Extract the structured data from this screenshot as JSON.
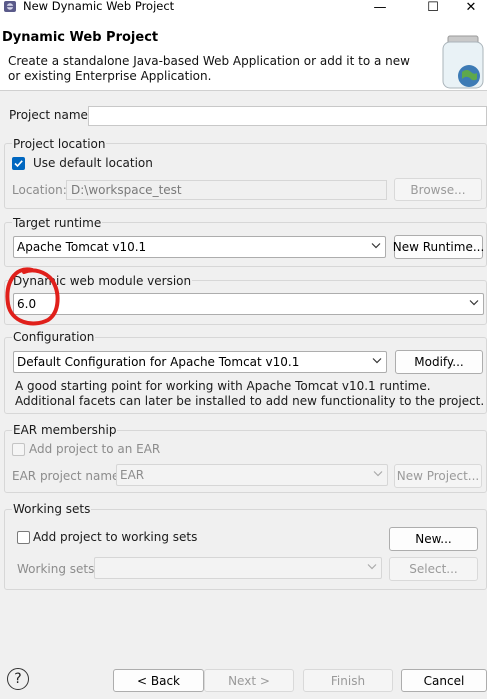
{
  "window": {
    "title": "New Dynamic Web Project",
    "minimize_glyph": "—",
    "maximize_glyph": "☐",
    "close_glyph": "✕"
  },
  "header": {
    "title": "Dynamic Web Project",
    "description": "Create a standalone Java-based Web Application or add it to a new or existing Enterprise Application."
  },
  "project_name": {
    "label": "Project name:",
    "value": ""
  },
  "project_location": {
    "group_label": "Project location",
    "use_default_label": "Use default location",
    "use_default_checked": true,
    "location_label": "Location:",
    "location_value": "D:\\workspace_test",
    "browse_label": "Browse..."
  },
  "target_runtime": {
    "group_label": "Target runtime",
    "selected": "Apache Tomcat v10.1",
    "new_runtime_label": "New Runtime..."
  },
  "module_version": {
    "group_label": "Dynamic web module version",
    "selected": "6.0",
    "annotation_color": "#e0201b"
  },
  "configuration": {
    "group_label": "Configuration",
    "selected": "Default Configuration for Apache Tomcat v10.1",
    "modify_label": "Modify...",
    "description": "A good starting point for working with Apache Tomcat v10.1 runtime. Additional facets can later be installed to add new functionality to the project."
  },
  "ear": {
    "group_label": "EAR membership",
    "add_label": "Add project to an EAR",
    "project_name_label": "EAR project name:",
    "project_name_value": "EAR",
    "new_project_label": "New Project..."
  },
  "working_sets": {
    "group_label": "Working sets",
    "add_label": "Add project to working sets",
    "new_label": "New...",
    "sets_label": "Working sets:",
    "sets_value": "",
    "select_label": "Select..."
  },
  "footer": {
    "help_glyph": "?",
    "back_label": "< Back",
    "next_label": "Next >",
    "finish_label": "Finish",
    "cancel_label": "Cancel"
  },
  "colors": {
    "accent": "#0067c0",
    "dialog_bg": "#f0f0f0"
  }
}
